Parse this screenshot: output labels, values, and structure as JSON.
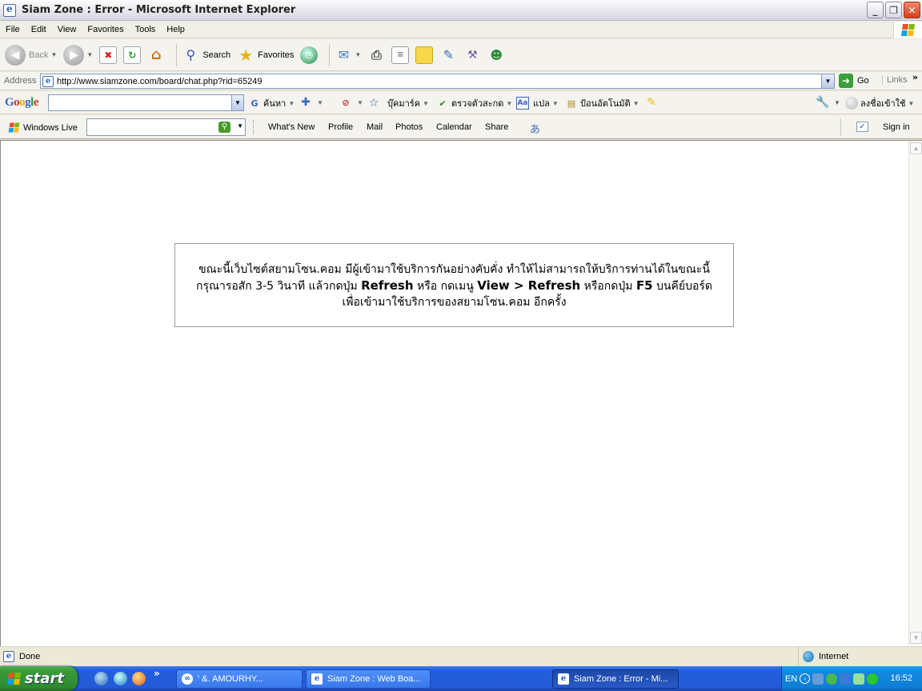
{
  "window": {
    "title": "Siam Zone : Error - Microsoft Internet Explorer"
  },
  "menu": [
    "File",
    "Edit",
    "View",
    "Favorites",
    "Tools",
    "Help"
  ],
  "toolbar": {
    "back": "Back",
    "search": "Search",
    "favorites": "Favorites"
  },
  "address": {
    "label": "Address",
    "url": "http://www.siamzone.com/board/chat.php?rid=65249",
    "go": "Go",
    "links": "Links"
  },
  "google_toolbar": {
    "logo": "Google",
    "search": "ค้นหา",
    "bookmarks": "บุ๊คมาร์ค",
    "spellcheck": "ตรวจตัวสะกด",
    "translate": "แปล",
    "autofill": "ป้อนอัตโนมัติ",
    "signin": "ลงชื่อเข้าใช้"
  },
  "windows_live": {
    "label": "Windows Live",
    "links": [
      "What's New",
      "Profile",
      "Mail",
      "Photos",
      "Calendar",
      "Share"
    ],
    "signin": "Sign in"
  },
  "notice": {
    "line1": "ขณะนี้เว็บไซต์สยามโซน.คอม มีผู้เข้ามาใช้บริการกันอย่างคับคั่ง ทำให้ไม่สามารถให้บริการท่านได้ในขณะนี้",
    "line2_a": "กรุณารอสัก 3-5 วินาที แล้วกดปุ่ม",
    "refresh": "Refresh",
    "line2_b": "หรือ กดเมนู",
    "view_refresh": "View > Refresh",
    "line2_c": "หรือกดปุ่ม",
    "f5": "F5",
    "line2_d": "บนคีย์บอร์ด",
    "line3": "เพื่อเข้ามาใช้บริการของสยามโซน.คอม อีกครั้ง"
  },
  "status": {
    "text": "Done",
    "zone": "Internet"
  },
  "taskbar": {
    "start": "start",
    "tasks": [
      {
        "label": "'          &. AMOURHY...",
        "active": false
      },
      {
        "label": "Siam Zone : Web Boa...",
        "active": false
      },
      {
        "label": "Siam Zone : Error - Mi...",
        "active": true
      }
    ],
    "lang": "EN",
    "clock": "16:52"
  },
  "colors": {
    "taskbar": "#245edb",
    "start": "#3a9a3a",
    "tray": "#0e7ed6",
    "accent_link": "#1f5fc7"
  }
}
